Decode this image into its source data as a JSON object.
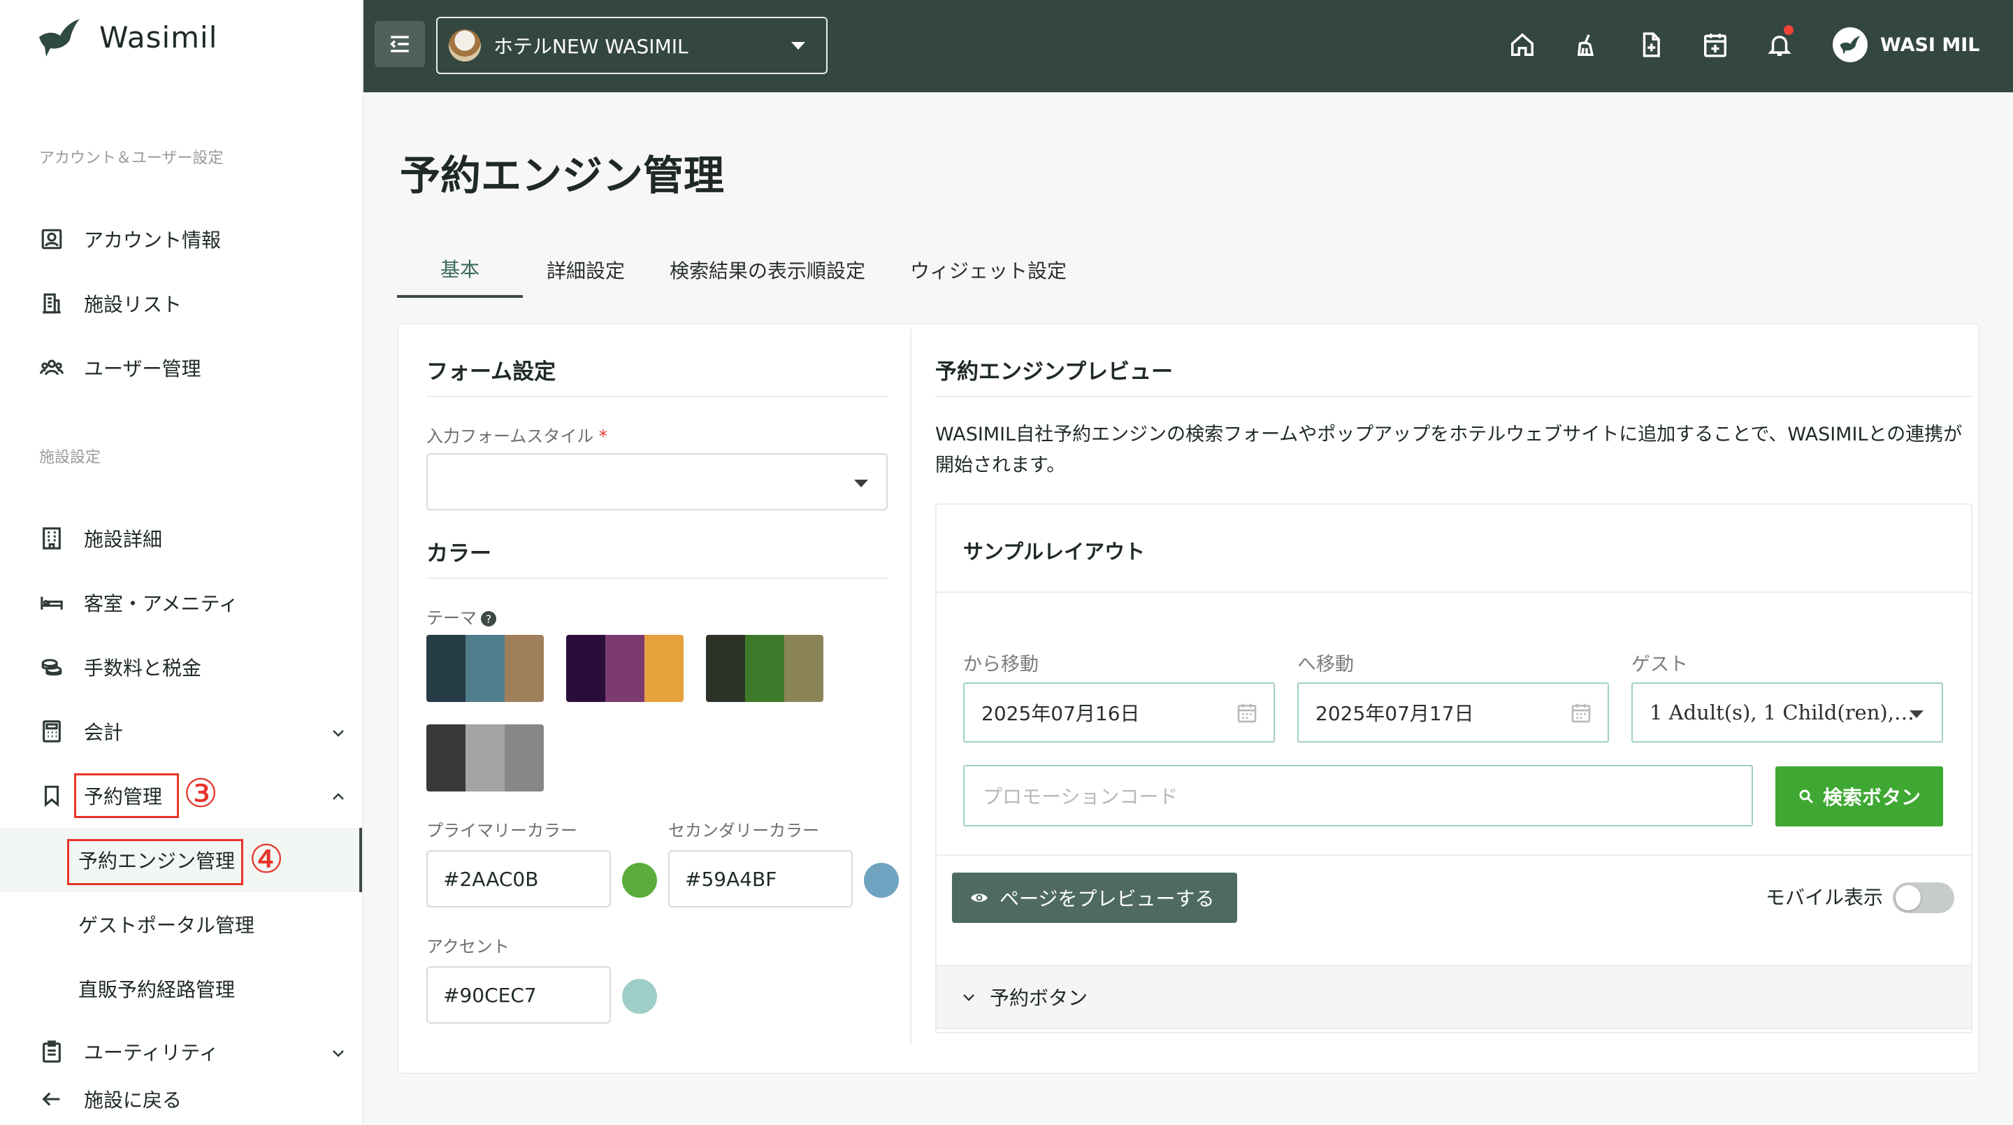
{
  "app": {
    "name": "Wasimil"
  },
  "sidebar": {
    "section_account": "アカウント＆ユーザー設定",
    "account_items": [
      {
        "label": "アカウント情報",
        "icon": "account-icon"
      },
      {
        "label": "施設リスト",
        "icon": "building-icon"
      },
      {
        "label": "ユーザー管理",
        "icon": "users-icon"
      }
    ],
    "section_facility": "施設設定",
    "facility_items": [
      {
        "label": "施設詳細",
        "icon": "facility-icon"
      },
      {
        "label": "客室・アメニティ",
        "icon": "bed-icon"
      },
      {
        "label": "手数料と税金",
        "icon": "coins-icon"
      },
      {
        "label": "会計",
        "icon": "calculator-icon"
      },
      {
        "label": "予約管理",
        "icon": "bookmark-icon"
      }
    ],
    "reservation_subitems": [
      {
        "label": "予約エンジン管理"
      },
      {
        "label": "ゲストポータル管理"
      },
      {
        "label": "直販予約経路管理"
      }
    ],
    "utility_label": "ユーティリティ",
    "back_label": "施設に戻る",
    "annotations": {
      "step3": "③",
      "step4": "④"
    }
  },
  "header": {
    "hotel_name": "ホテルNEW WASIMIL",
    "user_name": "WASI MIL",
    "icons": [
      "home-icon",
      "broom-icon",
      "file-plus-icon",
      "calendar-plus-icon",
      "bell-icon"
    ]
  },
  "main": {
    "title": "予約エンジン管理",
    "tabs": [
      {
        "label": "基本",
        "active": true
      },
      {
        "label": "詳細設定"
      },
      {
        "label": "検索結果の表示順設定"
      },
      {
        "label": "ウィジェット設定"
      }
    ]
  },
  "form": {
    "title": "フォーム設定",
    "input_style_label": "入力フォームスタイル",
    "required_mark": "*",
    "input_style_value": "",
    "color_title": "カラー",
    "theme_label": "テーマ",
    "help_glyph": "?",
    "themes": [
      [
        "#263c46",
        "#4f7d8c",
        "#a07f5d"
      ],
      [
        "#2a0d3a",
        "#7c3b6f",
        "#e6a03c"
      ],
      [
        "#2e3327",
        "#3f7a2a",
        "#8b8458"
      ],
      [
        "#393939",
        "#a4a4a4",
        "#878787"
      ]
    ],
    "primary_label": "プライマリーカラー",
    "primary_value": "#2AAC0B",
    "primary_dot": "#5aad3a",
    "secondary_label": "セカンダリーカラー",
    "secondary_value": "#59A4BF",
    "secondary_dot": "#6fa3bf",
    "accent_label": "アクセント",
    "accent_value": "#90CEC7",
    "accent_dot": "#9fcdc7"
  },
  "preview": {
    "title": "予約エンジンプレビュー",
    "description": "WASIMIL自社予約エンジンの検索フォームやポップアップをホテルウェブサイトに追加することで、WASIMILとの連携が開始されます。",
    "sample_title": "サンプルレイアウト",
    "from_label": "から移動",
    "from_value": "2025年07月16日",
    "to_label": "へ移動",
    "to_value": "2025年07月17日",
    "guest_label": "ゲスト",
    "guest_value": "1 Adult(s), 1 Child(ren),…",
    "promo_placeholder": "プロモーションコード",
    "search_label": "検索ボタン",
    "preview_button": "ページをプレビューする",
    "mobile_label": "モバイル表示",
    "mobile_on": false,
    "accordion_label": "予約ボタン"
  }
}
